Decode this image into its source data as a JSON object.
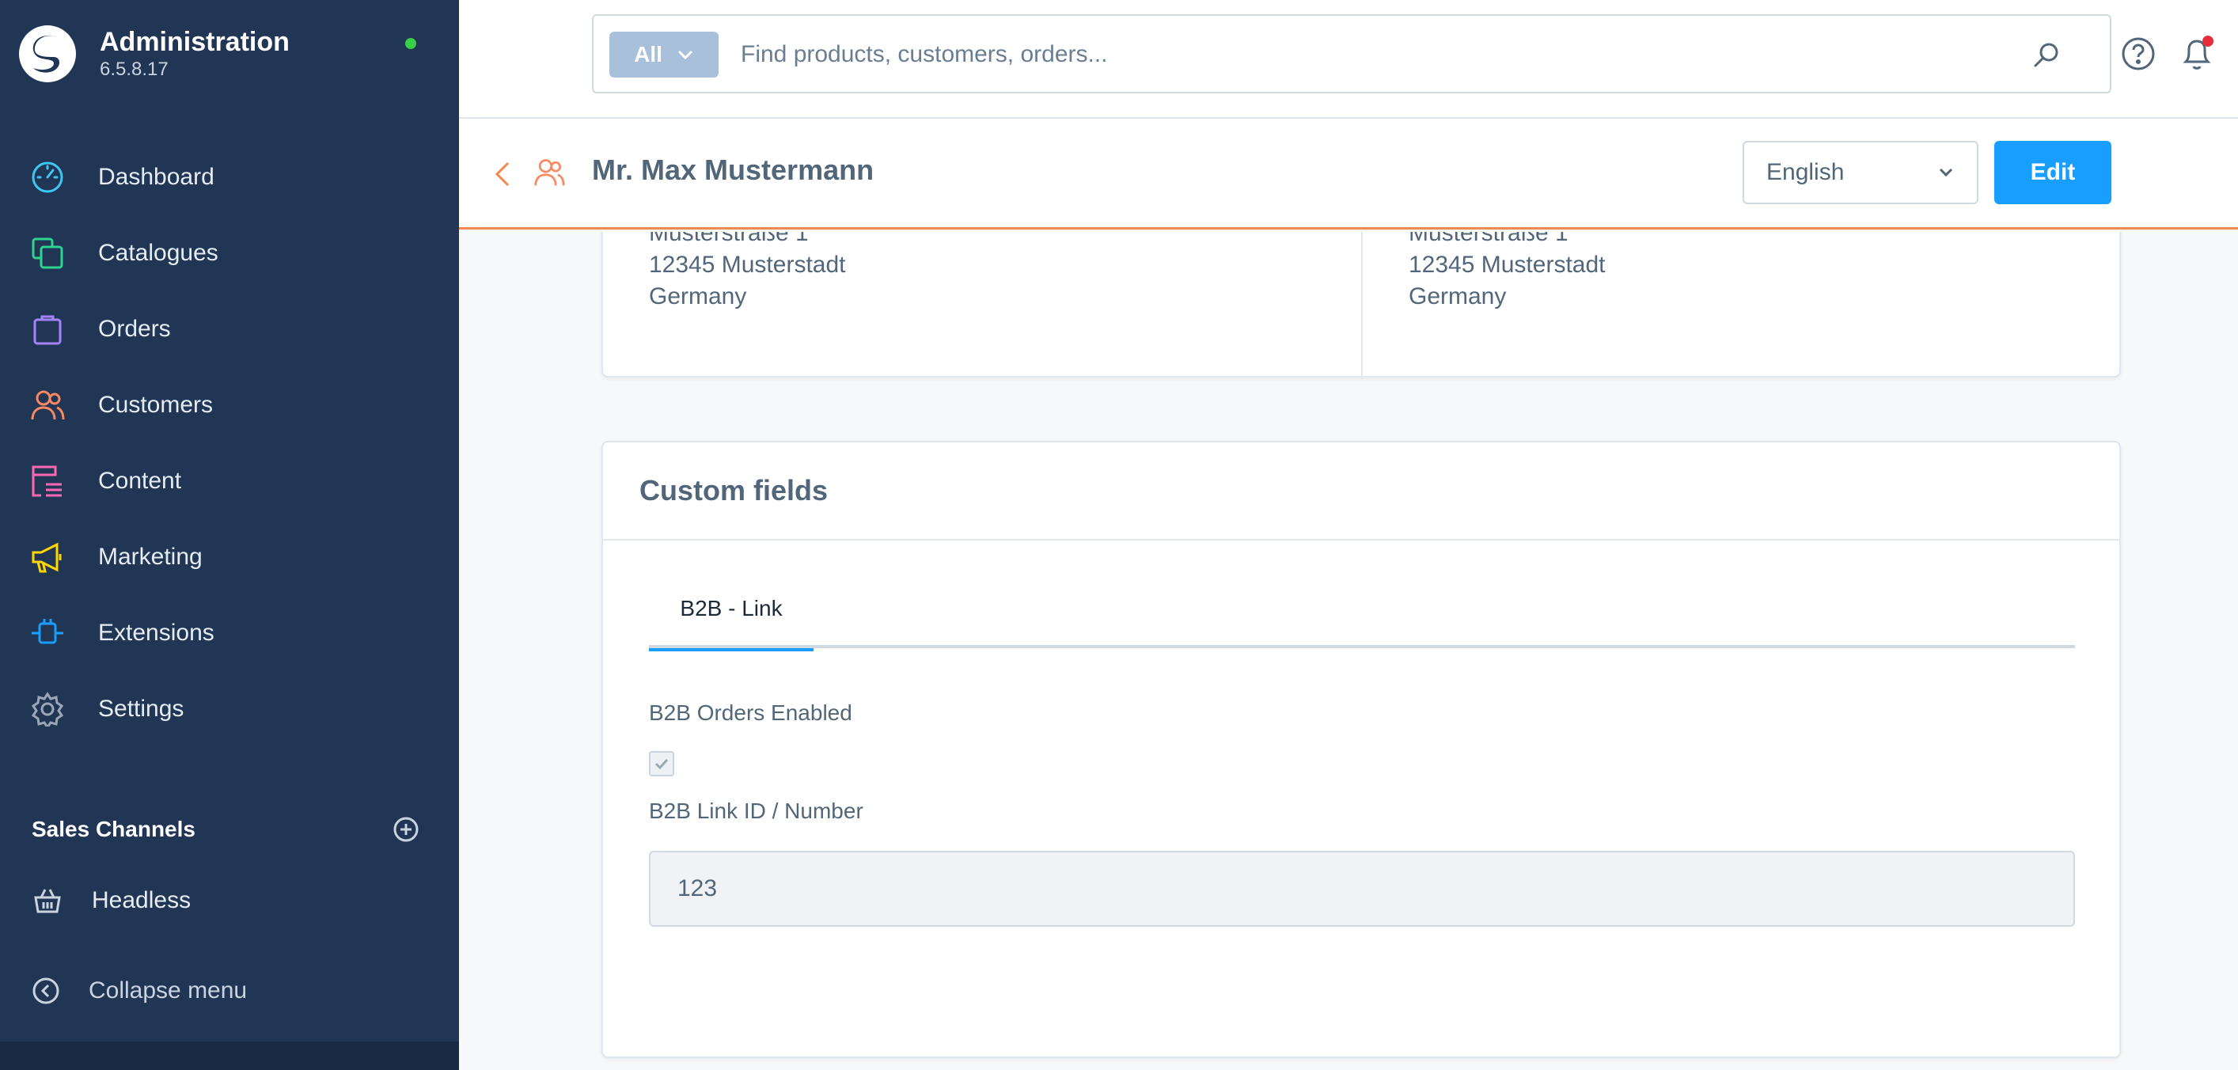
{
  "app": {
    "title": "Administration",
    "version": "6.5.8.17",
    "status_color": "#37d046"
  },
  "sidebar": {
    "items": [
      {
        "label": "Dashboard",
        "icon": "dashboard-icon",
        "color": "#3ec7f0"
      },
      {
        "label": "Catalogues",
        "icon": "catalogues-icon",
        "color": "#2fd38f"
      },
      {
        "label": "Orders",
        "icon": "orders-icon",
        "color": "#a383ff"
      },
      {
        "label": "Customers",
        "icon": "customers-icon",
        "color": "#f88962"
      },
      {
        "label": "Content",
        "icon": "content-icon",
        "color": "#ff68b4"
      },
      {
        "label": "Marketing",
        "icon": "marketing-icon",
        "color": "#ffd700"
      },
      {
        "label": "Extensions",
        "icon": "extensions-icon",
        "color": "#189eff"
      },
      {
        "label": "Settings",
        "icon": "settings-icon",
        "color": "#9aa8b5"
      }
    ],
    "sales_channels_title": "Sales Channels",
    "sales_channels": [
      {
        "label": "Headless",
        "icon": "basket-icon"
      }
    ],
    "collapse_label": "Collapse menu"
  },
  "search": {
    "filter_label": "All",
    "placeholder": "Find products, customers, orders..."
  },
  "header": {
    "title": "Mr. Max Mustermann",
    "language": "English",
    "edit_label": "Edit"
  },
  "addresses": [
    {
      "lines": [
        "Musterstraße 1",
        "12345 Musterstadt",
        "Germany"
      ]
    },
    {
      "lines": [
        "Musterstraße 1",
        "12345 Musterstadt",
        "Germany"
      ]
    }
  ],
  "custom_fields": {
    "title": "Custom fields",
    "tabs": [
      {
        "label": "B2B - Link",
        "active": true
      }
    ],
    "b2b_orders_enabled_label": "B2B Orders Enabled",
    "b2b_orders_enabled": true,
    "b2b_link_id_label": "B2B Link ID / Number",
    "b2b_link_id_value": "123"
  },
  "colors": {
    "sidebar_bg": "#213555",
    "accent": "#189eff",
    "header_border": "#f08a50"
  }
}
